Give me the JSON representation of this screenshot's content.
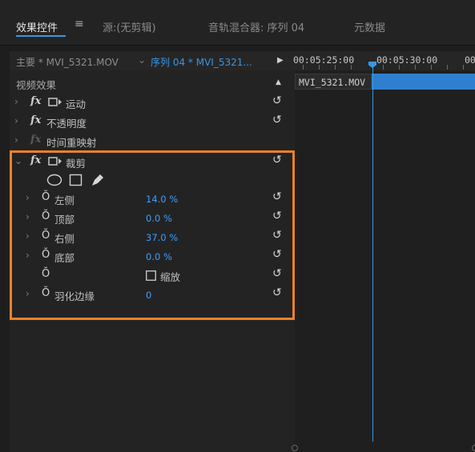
{
  "tabs": [
    {
      "label": "效果控件",
      "active": true
    },
    {
      "label": "源:(无剪辑)",
      "active": false
    },
    {
      "label": "音轨混合器: 序列 04",
      "active": false
    },
    {
      "label": "元数据",
      "active": false
    }
  ],
  "menu_icon": "≡",
  "header": {
    "master_clip": "主要 * MVI_5321.MOV",
    "sequence_clip": "序列 04 * MVI_5321...",
    "play_glyph": "▶"
  },
  "section": {
    "label": "视频效果",
    "collapse_glyph": "▲"
  },
  "effects": [
    {
      "label": "运动",
      "has_motion_icon": true
    },
    {
      "label": "不透明度",
      "has_motion_icon": false
    },
    {
      "label": "时间重映射",
      "has_motion_icon": false
    }
  ],
  "crop": {
    "label": "裁剪",
    "properties": [
      {
        "label": "左侧",
        "value": "14.0 %"
      },
      {
        "label": "顶部",
        "value": "0.0 %"
      },
      {
        "label": "右侧",
        "value": "37.0 %"
      },
      {
        "label": "底部",
        "value": "0.0 %"
      }
    ],
    "zoom_label": "缩放",
    "zoom_checked": false,
    "feather_label": "羽化边缘",
    "feather_value": "0"
  },
  "timeline": {
    "timecodes": [
      "00:05:25:00",
      "00:05:30:00",
      "00"
    ],
    "clip_label": "MVI_5321.MOV"
  },
  "glyphs": {
    "fx": "fx",
    "chevron_right": "›",
    "chevron_down": "⌄",
    "reset": "↺",
    "stopwatch": "Ŏ"
  },
  "colors": {
    "accent": "#3a96e2",
    "highlight_box": "#e8822a",
    "value": "#3aa0ff"
  }
}
